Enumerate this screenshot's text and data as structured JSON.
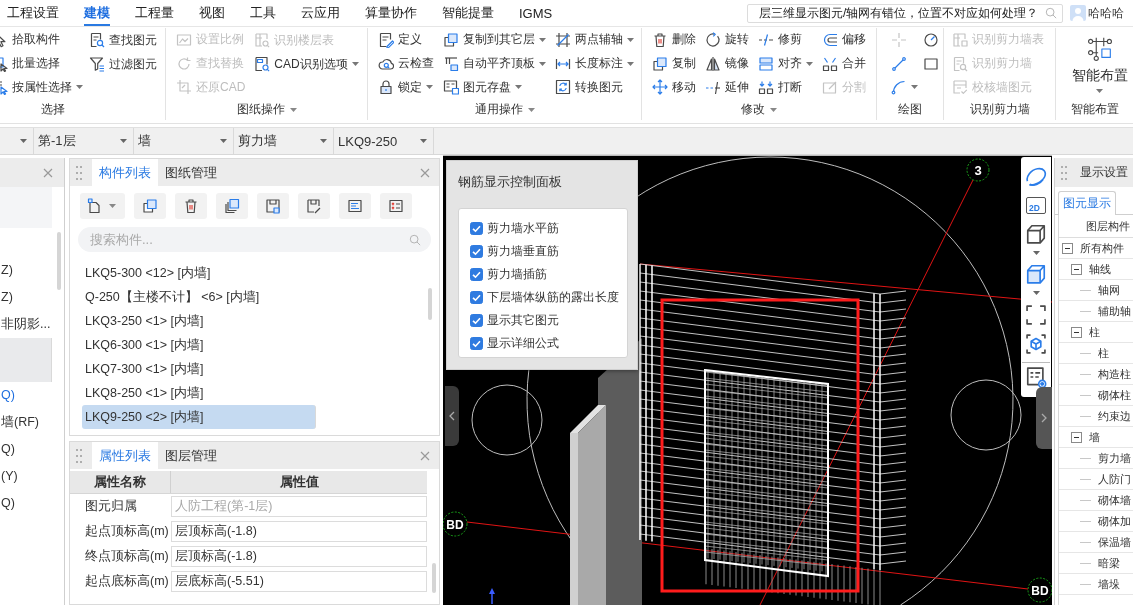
{
  "menu": {
    "tabs": [
      {
        "label": "工程设置",
        "selected": false
      },
      {
        "label": "建模",
        "selected": true
      },
      {
        "label": "工程量",
        "selected": false
      },
      {
        "label": "视图",
        "selected": false
      },
      {
        "label": "工具",
        "selected": false
      },
      {
        "label": "云应用",
        "selected": false
      },
      {
        "label": "算量协作",
        "selected": false
      },
      {
        "label": "智能提量",
        "selected": false
      },
      {
        "label": "IGMS",
        "selected": false
      }
    ],
    "search": {
      "value": "层三维显示图元/轴网有错位，位置不对应如何处理？"
    },
    "user": {
      "name": "哈哈哈"
    }
  },
  "ribbon": {
    "groups": [
      {
        "label": "选择",
        "dropdown": false,
        "kind": "columns",
        "columns": [
          [
            {
              "label": "拾取构件",
              "disabled": false,
              "dropdown": false
            },
            {
              "label": "批量选择",
              "disabled": false,
              "dropdown": false
            },
            {
              "label": "按属性选择",
              "disabled": false,
              "dropdown": true
            }
          ],
          [
            {
              "label": "查找图元",
              "disabled": false,
              "dropdown": false
            },
            {
              "label": "过滤图元",
              "disabled": false,
              "dropdown": false
            }
          ]
        ]
      },
      {
        "label": "图纸操作",
        "dropdown": true,
        "kind": "columns",
        "columns": [
          [
            {
              "label": "设置比例",
              "disabled": true,
              "dropdown": false
            },
            {
              "label": "查找替换",
              "disabled": true,
              "dropdown": false
            },
            {
              "label": "还原CAD",
              "disabled": true,
              "dropdown": false
            }
          ],
          [
            {
              "label": "识别楼层表",
              "disabled": true,
              "dropdown": false
            },
            {
              "label": "CAD识别选项",
              "disabled": false,
              "dropdown": true
            }
          ]
        ]
      },
      {
        "label": "通用操作",
        "dropdown": true,
        "kind": "columns",
        "columns": [
          [
            {
              "label": "定义",
              "disabled": false,
              "dropdown": false
            },
            {
              "label": "云检查",
              "disabled": false,
              "dropdown": false
            },
            {
              "label": "锁定",
              "disabled": false,
              "dropdown": true
            }
          ],
          [
            {
              "label": "复制到其它层",
              "disabled": false,
              "dropdown": true
            },
            {
              "label": "自动平齐顶板",
              "disabled": false,
              "dropdown": true
            },
            {
              "label": "图元存盘",
              "disabled": false,
              "dropdown": true
            }
          ],
          [
            {
              "label": "两点辅轴",
              "disabled": false,
              "dropdown": true
            },
            {
              "label": "长度标注",
              "disabled": false,
              "dropdown": true
            },
            {
              "label": "转换图元",
              "disabled": false,
              "dropdown": false
            }
          ]
        ]
      },
      {
        "label": "修改",
        "dropdown": true,
        "kind": "columns",
        "columns": [
          [
            {
              "label": "删除",
              "disabled": false,
              "dropdown": false
            },
            {
              "label": "复制",
              "disabled": false,
              "dropdown": false
            },
            {
              "label": "移动",
              "disabled": false,
              "dropdown": false
            }
          ],
          [
            {
              "label": "旋转",
              "disabled": false,
              "dropdown": false
            },
            {
              "label": "镜像",
              "disabled": false,
              "dropdown": false
            },
            {
              "label": "延伸",
              "disabled": false,
              "dropdown": false
            }
          ],
          [
            {
              "label": "修剪",
              "disabled": false,
              "dropdown": false
            },
            {
              "label": "对齐",
              "disabled": false,
              "dropdown": true
            },
            {
              "label": "打断",
              "disabled": false,
              "dropdown": false
            }
          ],
          [
            {
              "label": "偏移",
              "disabled": false,
              "dropdown": false
            },
            {
              "label": "合并",
              "disabled": false,
              "dropdown": false
            },
            {
              "label": "分割",
              "disabled": true,
              "dropdown": false
            }
          ]
        ]
      },
      {
        "label": "绘图",
        "dropdown": false,
        "kind": "icons",
        "columns": [
          [
            {
              "disabled": true,
              "dropdown": false
            },
            {
              "disabled": false,
              "dropdown": false
            },
            {
              "disabled": false,
              "dropdown": true
            }
          ],
          [
            {
              "disabled": false,
              "dropdown": false
            },
            {
              "disabled": false,
              "dropdown": false
            }
          ]
        ]
      },
      {
        "label": "识别剪力墙",
        "dropdown": false,
        "kind": "columns",
        "columns": [
          [
            {
              "label": "识别剪力墙表",
              "disabled": true,
              "dropdown": false
            },
            {
              "label": "识别剪力墙",
              "disabled": true,
              "dropdown": false
            },
            {
              "label": "校核墙图元",
              "disabled": true,
              "dropdown": false
            }
          ]
        ]
      },
      {
        "label": "智能布置",
        "dropdown": false,
        "kind": "large",
        "items": [
          {
            "label": "智能布置",
            "dropdown": true
          }
        ]
      }
    ]
  },
  "selectors": [
    {
      "value": "第-1层"
    },
    {
      "value": "墙"
    },
    {
      "value": "剪力墙"
    },
    {
      "value": "LKQ9-250"
    }
  ],
  "left_panel": {
    "rows": [
      {
        "kind": "text",
        "text": "Z)",
        "selected": false,
        "highlighted": false
      },
      {
        "kind": "text",
        "text": "Z)",
        "selected": false,
        "highlighted": false
      },
      {
        "kind": "text",
        "text": "非阴影...",
        "selected": false,
        "highlighted": false
      },
      {
        "kind": "blank",
        "selected": true,
        "highlighted": false
      },
      {
        "kind": "text",
        "text": "Q)",
        "selected": false,
        "highlighted": true
      },
      {
        "kind": "text",
        "text": "墙(RF)",
        "selected": false,
        "highlighted": false
      },
      {
        "kind": "text",
        "text": "Q)",
        "selected": false,
        "highlighted": false
      },
      {
        "kind": "text",
        "text": "(Y)",
        "selected": false,
        "highlighted": false
      },
      {
        "kind": "text",
        "text": "Q)",
        "selected": false,
        "highlighted": false
      }
    ]
  },
  "component_panel": {
    "tabs": [
      {
        "label": "构件列表",
        "selected": true
      },
      {
        "label": "图纸管理",
        "selected": false
      }
    ],
    "search": {
      "placeholder": "搜索构件..."
    },
    "items": [
      {
        "label": "LKQ5-300 <12> [内墙]",
        "selected": false
      },
      {
        "label": "Q-250【主楼不计】 <6> [内墙]",
        "selected": false
      },
      {
        "label": "LKQ3-250 <1> [内墙]",
        "selected": false
      },
      {
        "label": "LKQ6-300 <1> [内墙]",
        "selected": false
      },
      {
        "label": "LKQ7-300 <1> [内墙]",
        "selected": false
      },
      {
        "label": "LKQ8-250 <1> [内墙]",
        "selected": false
      },
      {
        "label": "LKQ9-250 <2> [内墙]",
        "selected": true
      }
    ]
  },
  "property_panel": {
    "tabs": [
      {
        "label": "属性列表",
        "selected": true
      },
      {
        "label": "图层管理",
        "selected": false
      }
    ],
    "columns": [
      "属性名称",
      "属性值"
    ],
    "rows": [
      {
        "name": "图元归属",
        "value": "人防工程(第-1层)",
        "readonly": true
      },
      {
        "name": "起点顶标高(m)",
        "value": "层顶标高(-1.8)",
        "readonly": false
      },
      {
        "name": "终点顶标高(m)",
        "value": "层顶标高(-1.8)",
        "readonly": false
      },
      {
        "name": "起点底标高(m)",
        "value": "层底标高(-5.51)",
        "readonly": false
      }
    ]
  },
  "rebar_panel": {
    "title": "钢筋显示控制面板",
    "options": [
      {
        "label": "剪力墙水平筋",
        "checked": true
      },
      {
        "label": "剪力墙垂直筋",
        "checked": true
      },
      {
        "label": "剪力墙插筋",
        "checked": true
      },
      {
        "label": "下层墙体纵筋的露出长度",
        "checked": true
      },
      {
        "label": "显示其它图元",
        "checked": true
      },
      {
        "label": "显示详细公式",
        "checked": true
      }
    ]
  },
  "viewport": {
    "axis_markers": [
      "3",
      "BD",
      "BD"
    ]
  },
  "view_toolbar": {
    "items": [
      {
        "kind": "orbit",
        "dropdown": false
      },
      {
        "kind": "label",
        "text": "2D",
        "dropdown": false
      },
      {
        "kind": "cube",
        "dropdown": true
      },
      {
        "kind": "cube_filled",
        "dropdown": true
      },
      {
        "kind": "frame",
        "dropdown": false
      },
      {
        "kind": "frame_cube",
        "dropdown": false
      },
      {
        "kind": "legend",
        "dropdown": false
      }
    ]
  },
  "display_settings": {
    "title": "显示设置",
    "tabs": [
      {
        "label": "图元显示",
        "selected": true
      }
    ],
    "column": "图层构件",
    "tree": [
      {
        "label": "所有构件",
        "expanded": true,
        "children": [
          {
            "label": "轴线",
            "expanded": true,
            "children": [
              {
                "label": "轴网"
              },
              {
                "label": "辅助轴"
              }
            ]
          },
          {
            "label": "柱",
            "expanded": true,
            "children": [
              {
                "label": "柱"
              },
              {
                "label": "构造柱"
              },
              {
                "label": "砌体柱"
              },
              {
                "label": "约束边"
              }
            ]
          },
          {
            "label": "墙",
            "expanded": true,
            "children": [
              {
                "label": "剪力墙"
              },
              {
                "label": "人防门"
              },
              {
                "label": "砌体墙"
              },
              {
                "label": "砌体加"
              },
              {
                "label": "保温墙"
              },
              {
                "label": "暗梁"
              },
              {
                "label": "墙垛"
              }
            ]
          }
        ]
      }
    ]
  }
}
